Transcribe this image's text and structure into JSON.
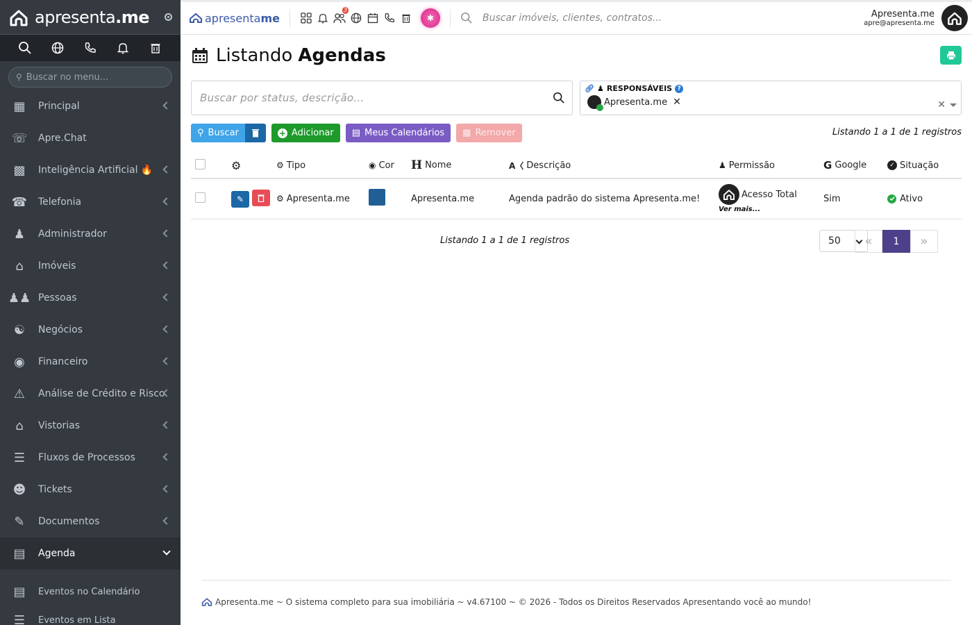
{
  "brand": {
    "name_prefix": "apresenta",
    "name_suffix": ".me",
    "top_logo_prefix": "apresenta",
    "top_logo_suffix": "me"
  },
  "sidebar": {
    "search_placeholder": "Buscar no menu...",
    "items": [
      {
        "label": "Principal",
        "icon": "dashboard-icon"
      },
      {
        "label": "Apre.Chat",
        "icon": "whatsapp-icon"
      },
      {
        "label": "Inteligência Artificial 🔥",
        "icon": "robot-icon"
      },
      {
        "label": "Telefonia",
        "icon": "phone-icon"
      },
      {
        "label": "Administrador",
        "icon": "user-icon"
      },
      {
        "label": "Imóveis",
        "icon": "home-icon"
      },
      {
        "label": "Pessoas",
        "icon": "people-icon"
      },
      {
        "label": "Negócios",
        "icon": "handshake-icon"
      },
      {
        "label": "Financeiro",
        "icon": "dollar-icon"
      },
      {
        "label": "Análise de Crédito e Risco",
        "icon": "warning-icon"
      },
      {
        "label": "Vistorias",
        "icon": "house-search-icon"
      },
      {
        "label": "Fluxos de Processos",
        "icon": "filter-icon"
      },
      {
        "label": "Tickets",
        "icon": "support-icon"
      },
      {
        "label": "Documentos",
        "icon": "document-icon"
      },
      {
        "label": "Agenda",
        "icon": "calendar-icon"
      }
    ],
    "subitems": [
      {
        "label": "Eventos no Calendário",
        "icon": "calendar-clock-icon"
      },
      {
        "label": "Eventos em Lista",
        "icon": "list-icon"
      }
    ]
  },
  "topnav": {
    "notifications_badge": "3",
    "search_placeholder": "Buscar imóveis, clientes, contratos...",
    "user_name": "Apresenta.me",
    "user_email": "apre@apresenta.me"
  },
  "page": {
    "title_prefix": "Listando",
    "title_bold": "Agendas",
    "search_placeholder": "Buscar por status, descrição...",
    "responsaveis_label": "RESPONSÁVEIS",
    "responsavel_chip": "Apresenta.me",
    "buttons": {
      "buscar": "Buscar",
      "adicionar": "Adicionar",
      "meus_calendarios": "Meus Calendários",
      "remover": "Remover"
    },
    "count_text": "Listando 1 a 1 de 1 registros"
  },
  "table": {
    "headers": {
      "tipo": "Tipo",
      "cor": "Cor",
      "nome": "Nome",
      "descricao": "Descrição",
      "permissao": "Permissão",
      "google": "Google",
      "situacao": "Situação"
    },
    "rows": [
      {
        "tipo": "Apresenta.me",
        "cor": "#1f5f95",
        "nome": "Apresenta.me",
        "descricao": "Agenda padrão do sistema Apresenta.me!",
        "permissao": "Acesso Total",
        "permissao_more": "Ver mais...",
        "google": "Sim",
        "situacao": "Ativo"
      }
    ]
  },
  "pagination": {
    "per_page": "50",
    "current_page": "1"
  },
  "footer": {
    "text": "Apresenta.me ~ O sistema completo para sua imobiliária ~ v4.67100 ~ © 2026 - Todos os Direitos Reservados Apresentando você ao mundo!"
  }
}
